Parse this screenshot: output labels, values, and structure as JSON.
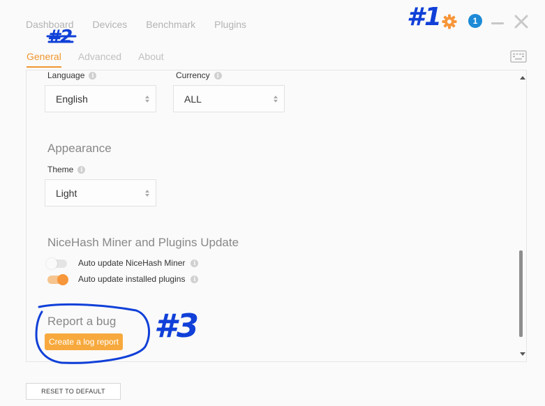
{
  "nav": {
    "items": [
      "Dashboard",
      "Devices",
      "Benchmark",
      "Plugins"
    ]
  },
  "controls": {
    "notification_count": "1",
    "icons": [
      "gear-icon",
      "minimize-icon",
      "close-icon"
    ],
    "accent": "#f0962e",
    "badge_color": "#1c8ad6"
  },
  "subtabs": {
    "items": [
      "General",
      "Advanced",
      "About"
    ],
    "active": "General"
  },
  "settings": {
    "language": {
      "label": "Language",
      "value": "English"
    },
    "currency": {
      "label": "Currency",
      "value": "ALL"
    },
    "appearance": {
      "title": "Appearance",
      "theme": {
        "label": "Theme",
        "value": "Light"
      }
    },
    "update": {
      "title": "NiceHash Miner and Plugins Update",
      "auto_update_miner": {
        "label": "Auto update NiceHash Miner",
        "enabled": false
      },
      "auto_update_plugins": {
        "label": "Auto update installed plugins",
        "enabled": true
      }
    },
    "bug": {
      "title": "Report a bug",
      "button": "Create a log report"
    }
  },
  "footer": {
    "reset_label": "RESET TO DEFAULT"
  },
  "annotations": {
    "one": "#1",
    "two": "#2",
    "three": "#3",
    "color": "#1040d8"
  }
}
